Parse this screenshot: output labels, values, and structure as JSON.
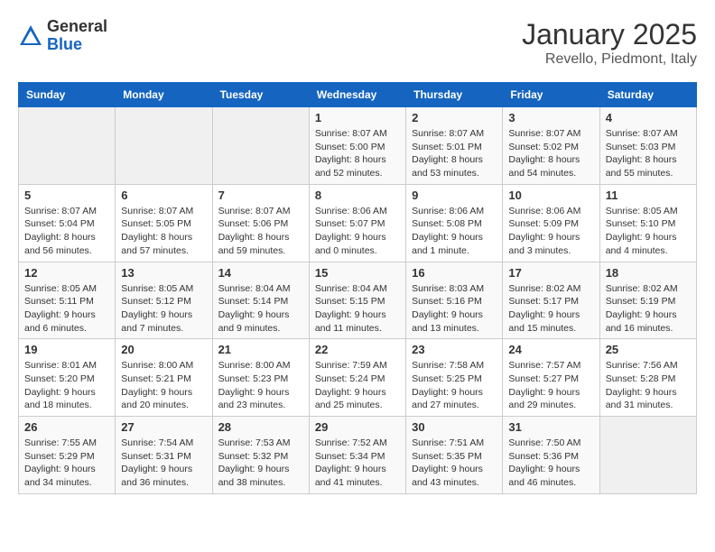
{
  "header": {
    "logo_general": "General",
    "logo_blue": "Blue",
    "title": "January 2025",
    "subtitle": "Revello, Piedmont, Italy"
  },
  "calendar": {
    "days_of_week": [
      "Sunday",
      "Monday",
      "Tuesday",
      "Wednesday",
      "Thursday",
      "Friday",
      "Saturday"
    ],
    "weeks": [
      [
        {
          "day": "",
          "info": ""
        },
        {
          "day": "",
          "info": ""
        },
        {
          "day": "",
          "info": ""
        },
        {
          "day": "1",
          "info": "Sunrise: 8:07 AM\nSunset: 5:00 PM\nDaylight: 8 hours and 52 minutes."
        },
        {
          "day": "2",
          "info": "Sunrise: 8:07 AM\nSunset: 5:01 PM\nDaylight: 8 hours and 53 minutes."
        },
        {
          "day": "3",
          "info": "Sunrise: 8:07 AM\nSunset: 5:02 PM\nDaylight: 8 hours and 54 minutes."
        },
        {
          "day": "4",
          "info": "Sunrise: 8:07 AM\nSunset: 5:03 PM\nDaylight: 8 hours and 55 minutes."
        }
      ],
      [
        {
          "day": "5",
          "info": "Sunrise: 8:07 AM\nSunset: 5:04 PM\nDaylight: 8 hours and 56 minutes."
        },
        {
          "day": "6",
          "info": "Sunrise: 8:07 AM\nSunset: 5:05 PM\nDaylight: 8 hours and 57 minutes."
        },
        {
          "day": "7",
          "info": "Sunrise: 8:07 AM\nSunset: 5:06 PM\nDaylight: 8 hours and 59 minutes."
        },
        {
          "day": "8",
          "info": "Sunrise: 8:06 AM\nSunset: 5:07 PM\nDaylight: 9 hours and 0 minutes."
        },
        {
          "day": "9",
          "info": "Sunrise: 8:06 AM\nSunset: 5:08 PM\nDaylight: 9 hours and 1 minute."
        },
        {
          "day": "10",
          "info": "Sunrise: 8:06 AM\nSunset: 5:09 PM\nDaylight: 9 hours and 3 minutes."
        },
        {
          "day": "11",
          "info": "Sunrise: 8:05 AM\nSunset: 5:10 PM\nDaylight: 9 hours and 4 minutes."
        }
      ],
      [
        {
          "day": "12",
          "info": "Sunrise: 8:05 AM\nSunset: 5:11 PM\nDaylight: 9 hours and 6 minutes."
        },
        {
          "day": "13",
          "info": "Sunrise: 8:05 AM\nSunset: 5:12 PM\nDaylight: 9 hours and 7 minutes."
        },
        {
          "day": "14",
          "info": "Sunrise: 8:04 AM\nSunset: 5:14 PM\nDaylight: 9 hours and 9 minutes."
        },
        {
          "day": "15",
          "info": "Sunrise: 8:04 AM\nSunset: 5:15 PM\nDaylight: 9 hours and 11 minutes."
        },
        {
          "day": "16",
          "info": "Sunrise: 8:03 AM\nSunset: 5:16 PM\nDaylight: 9 hours and 13 minutes."
        },
        {
          "day": "17",
          "info": "Sunrise: 8:02 AM\nSunset: 5:17 PM\nDaylight: 9 hours and 15 minutes."
        },
        {
          "day": "18",
          "info": "Sunrise: 8:02 AM\nSunset: 5:19 PM\nDaylight: 9 hours and 16 minutes."
        }
      ],
      [
        {
          "day": "19",
          "info": "Sunrise: 8:01 AM\nSunset: 5:20 PM\nDaylight: 9 hours and 18 minutes."
        },
        {
          "day": "20",
          "info": "Sunrise: 8:00 AM\nSunset: 5:21 PM\nDaylight: 9 hours and 20 minutes."
        },
        {
          "day": "21",
          "info": "Sunrise: 8:00 AM\nSunset: 5:23 PM\nDaylight: 9 hours and 23 minutes."
        },
        {
          "day": "22",
          "info": "Sunrise: 7:59 AM\nSunset: 5:24 PM\nDaylight: 9 hours and 25 minutes."
        },
        {
          "day": "23",
          "info": "Sunrise: 7:58 AM\nSunset: 5:25 PM\nDaylight: 9 hours and 27 minutes."
        },
        {
          "day": "24",
          "info": "Sunrise: 7:57 AM\nSunset: 5:27 PM\nDaylight: 9 hours and 29 minutes."
        },
        {
          "day": "25",
          "info": "Sunrise: 7:56 AM\nSunset: 5:28 PM\nDaylight: 9 hours and 31 minutes."
        }
      ],
      [
        {
          "day": "26",
          "info": "Sunrise: 7:55 AM\nSunset: 5:29 PM\nDaylight: 9 hours and 34 minutes."
        },
        {
          "day": "27",
          "info": "Sunrise: 7:54 AM\nSunset: 5:31 PM\nDaylight: 9 hours and 36 minutes."
        },
        {
          "day": "28",
          "info": "Sunrise: 7:53 AM\nSunset: 5:32 PM\nDaylight: 9 hours and 38 minutes."
        },
        {
          "day": "29",
          "info": "Sunrise: 7:52 AM\nSunset: 5:34 PM\nDaylight: 9 hours and 41 minutes."
        },
        {
          "day": "30",
          "info": "Sunrise: 7:51 AM\nSunset: 5:35 PM\nDaylight: 9 hours and 43 minutes."
        },
        {
          "day": "31",
          "info": "Sunrise: 7:50 AM\nSunset: 5:36 PM\nDaylight: 9 hours and 46 minutes."
        },
        {
          "day": "",
          "info": ""
        }
      ]
    ]
  }
}
